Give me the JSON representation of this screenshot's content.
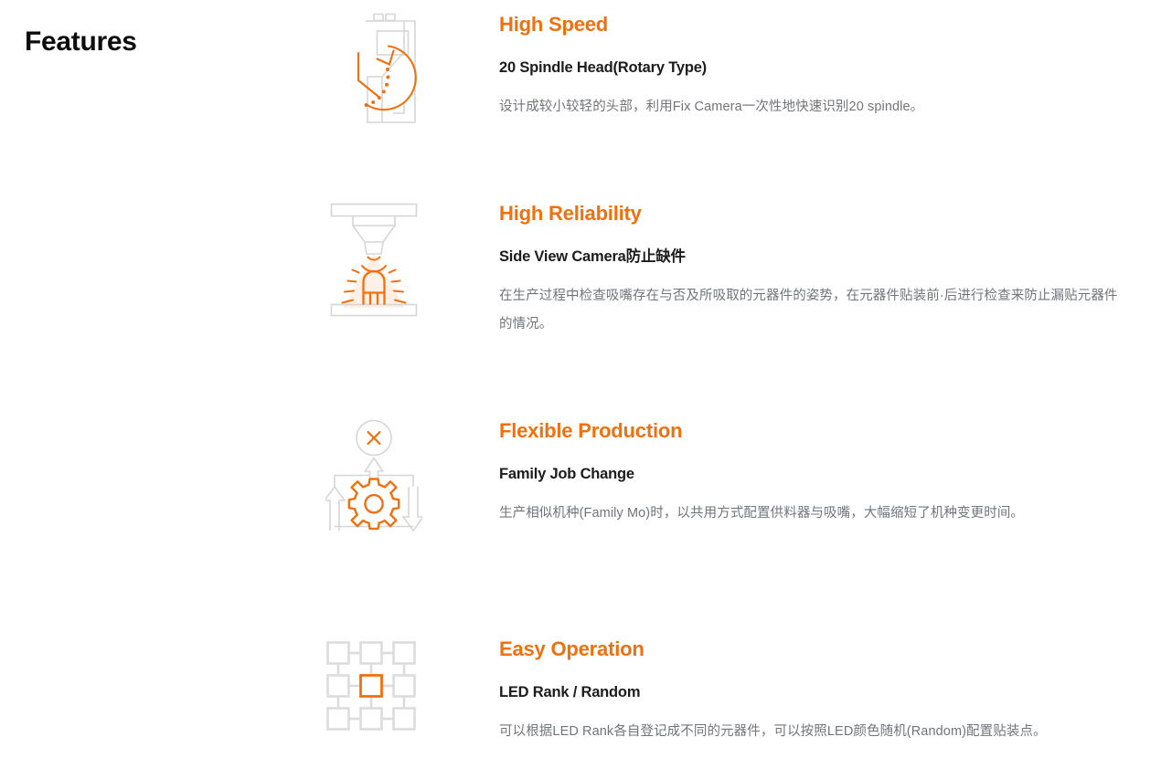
{
  "page": {
    "title": "Features",
    "background_color": "#ffffff",
    "accent_color": "#f1700e",
    "icon_line_color": "#d4d4d4",
    "heading_color": "#0c0c0c",
    "subtitle_color": "#1c1c1c",
    "body_color": "#70757a"
  },
  "features": [
    {
      "category": "High Speed",
      "subtitle": "20 Spindle Head(Rotary Type)",
      "description": "设计成较小较轻的头部，利用Fix Camera一次性地快速识别20 spindle。",
      "icon_name": "clock-machine-icon"
    },
    {
      "category": "High Reliability",
      "subtitle": "Side View Camera防止缺件",
      "description": "在生产过程中检查吸嘴存在与否及所吸取的元器件的姿势，在元器件贴装前·后进行检查来防止漏贴元器件的情况。",
      "icon_name": "nozzle-led-inspection-icon"
    },
    {
      "category": "Flexible Production",
      "subtitle": "Family Job Change",
      "description": "生产相似机种(Family Mo)时，以共用方式配置供料器与吸嘴，大幅缩短了机种变更时间。",
      "icon_name": "gear-loop-arrows-icon"
    },
    {
      "category": "Easy Operation",
      "subtitle": "LED Rank / Random",
      "description": "可以根据LED Rank各自登记成不同的元器件，可以按照LED颜色随机(Random)配置贴装点。",
      "icon_name": "led-rank-grid-icon"
    }
  ]
}
